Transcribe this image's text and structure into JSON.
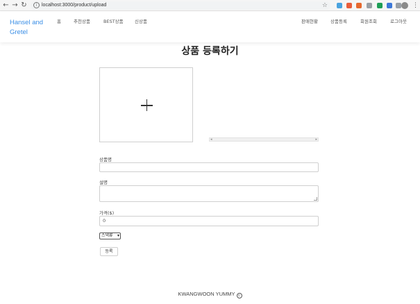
{
  "browser": {
    "url": "localhost:3000/product/upload",
    "back_icon": "←",
    "forward_icon": "→",
    "reload_icon": "↻",
    "lock_icon": "i",
    "star_icon": "☆",
    "menu_icon": "⋮",
    "extension_colors": [
      "#4aa3df",
      "#e85d3a",
      "#e6682e",
      "#9aa0a6",
      "#1e9e56",
      "#3c78d8",
      "#9aa0a6"
    ]
  },
  "nav": {
    "brand": "Hansel and Gretel",
    "left_links": [
      "홈",
      "추천상품",
      "BEST상품",
      "신상품"
    ],
    "right_links": [
      "판매현황",
      "상품등록",
      "회원조회",
      "로그아웃"
    ]
  },
  "main": {
    "title": "상품 등록하기",
    "upload_icon": "plus-icon",
    "scroll_left": "◂",
    "scroll_right": "▸",
    "name_label": "상품명",
    "name_value": "",
    "description_label": "설명",
    "description_value": "",
    "price_label": "가격($)",
    "price_value": "0",
    "category_selected": "스낵류",
    "select_caret": "▾",
    "submit_label": "등록"
  },
  "footer": {
    "text": "KWANGWOON YUMMY",
    "copyright_symbol": "c"
  }
}
